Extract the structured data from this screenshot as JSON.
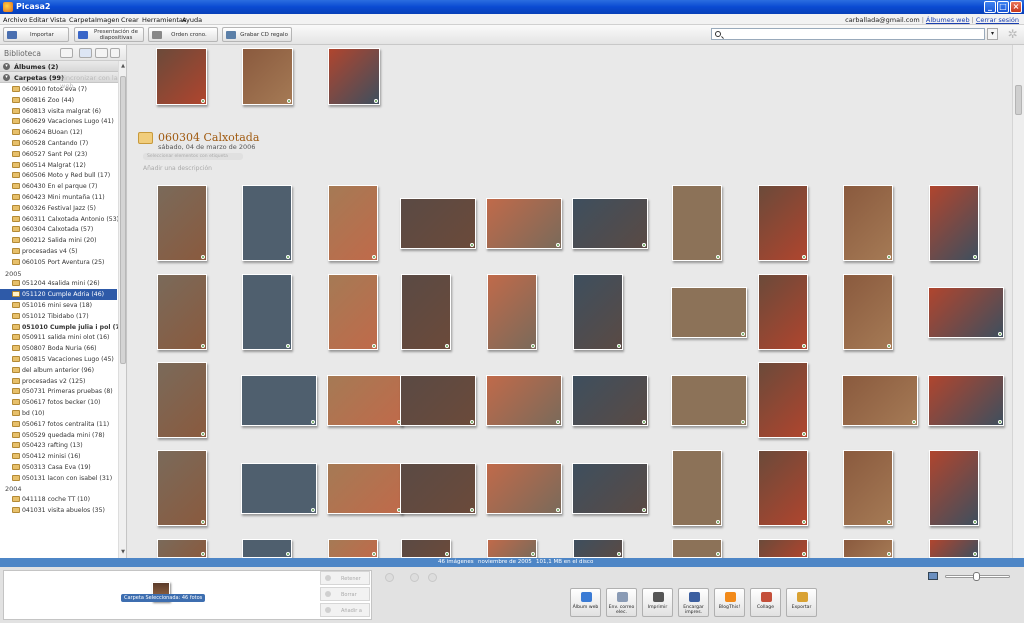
{
  "window": {
    "title": "Picasa2"
  },
  "menu": {
    "items": [
      "Archivo",
      "Editar",
      "Vista",
      "Carpeta",
      "Imagen",
      "Crear",
      "Herramientas",
      "Ayuda"
    ],
    "account_email": "carballada@gmail.com",
    "separator": "|",
    "web_albums_link": "Álbumes web",
    "sign_out_link": "Cerrar sesión"
  },
  "toolbar": {
    "import_label": "Importar",
    "slideshow_label": "Presentación de diapositivas",
    "timeline_label": "Orden crono.",
    "burn_label": "Grabar CD regalo",
    "search_value": ""
  },
  "sidebar": {
    "library_label": "Biblioteca",
    "albums_section": "Álbumes (2)",
    "folders_section": "Carpetas (99)",
    "folders_ghost": "Sincronizar con la web",
    "groups": [
      {
        "year": "",
        "folders": [
          {
            "label": "060910 fotos eva (7)"
          },
          {
            "label": "060816 Zoo (44)"
          },
          {
            "label": "060813 visita malgrat (6)"
          },
          {
            "label": "060629 Vacaciones Lugo (41)"
          },
          {
            "label": "060624 BUoan (12)"
          },
          {
            "label": "060528 Cantando (7)"
          },
          {
            "label": "060527 Sant Pol (23)"
          },
          {
            "label": "060514 Malgrat (12)"
          },
          {
            "label": "060506 Moto y Red bull (17)"
          },
          {
            "label": "060430 En el parque (7)"
          },
          {
            "label": "060423 Mini muntaña (11)"
          },
          {
            "label": "060326 Festival Jazz (5)"
          },
          {
            "label": "060311 Calxotada Antonio (53)"
          },
          {
            "label": "060304 Calxotada (57)"
          },
          {
            "label": "060212 Salida mini (20)"
          },
          {
            "label": "procesadas v4 (5)"
          },
          {
            "label": "060105 Port Aventura (25)"
          }
        ]
      },
      {
        "year": "2005",
        "folders": [
          {
            "label": "051204 4salida mini (26)"
          },
          {
            "label": "051120 Cumple Adria (46)",
            "selected": true
          },
          {
            "label": "051016 mini seva (18)"
          },
          {
            "label": "051012 Tibidabo (17)"
          },
          {
            "label": "051010 Cumple julia i pol (7)",
            "bold": true
          },
          {
            "label": "050911 salida mini olot (16)"
          },
          {
            "label": "050807 Boda Nuria (66)"
          },
          {
            "label": "050815 Vacaciones Lugo (45)"
          },
          {
            "label": "del album anterior (96)"
          },
          {
            "label": "procesadas v2 (125)"
          },
          {
            "label": "050731 Primeras pruebas (8)"
          },
          {
            "label": "050617 fotos becker (10)"
          },
          {
            "label": "bd (10)"
          },
          {
            "label": "050617 fotos centralita (11)"
          },
          {
            "label": "050529 quedada mini (78)"
          },
          {
            "label": "050423 rafting (13)"
          },
          {
            "label": "050412 minisi (16)"
          },
          {
            "label": "050313 Casa Eva (19)"
          },
          {
            "label": "050131 lacon con isabel (31)"
          }
        ]
      },
      {
        "year": "2004",
        "folders": [
          {
            "label": "041118 coche TT (10)"
          },
          {
            "label": "041031 visita abuelos (35)"
          }
        ]
      }
    ]
  },
  "main": {
    "album_title": "060304 Calxotada",
    "album_date": "sábado, 04 de marzo de 2006",
    "album_select": "Seleccionar elementos con etiqueta",
    "album_description": "Añadir una descripción"
  },
  "status": {
    "count": "46 imágenes",
    "date": "noviembre de 2005",
    "size": "101,1 MB en el disco"
  },
  "tray": {
    "selection_caption": "Carpeta Seleccionada: 46 fotos",
    "hold_label": "Retener",
    "clear_label": "Borrar",
    "add_label": "Añadir a",
    "actions": [
      {
        "label": "Álbum web",
        "color": "#3a7bd5"
      },
      {
        "label": "Env. correo elec.",
        "color": "#8a9bb5"
      },
      {
        "label": "Imprimir",
        "color": "#555555"
      },
      {
        "label": "Encargar impres.",
        "color": "#3c5fa0"
      },
      {
        "label": "BlogThis!",
        "color": "#f28a1a"
      },
      {
        "label": "Collage",
        "color": "#c44f3a"
      },
      {
        "label": "Exportar",
        "color": "#d9a233"
      }
    ]
  },
  "colors": {
    "titlebar": "#0a4ad2",
    "selection": "#2e5aa8",
    "status_bar": "#4e86c6",
    "album_title": "#a05a10"
  }
}
